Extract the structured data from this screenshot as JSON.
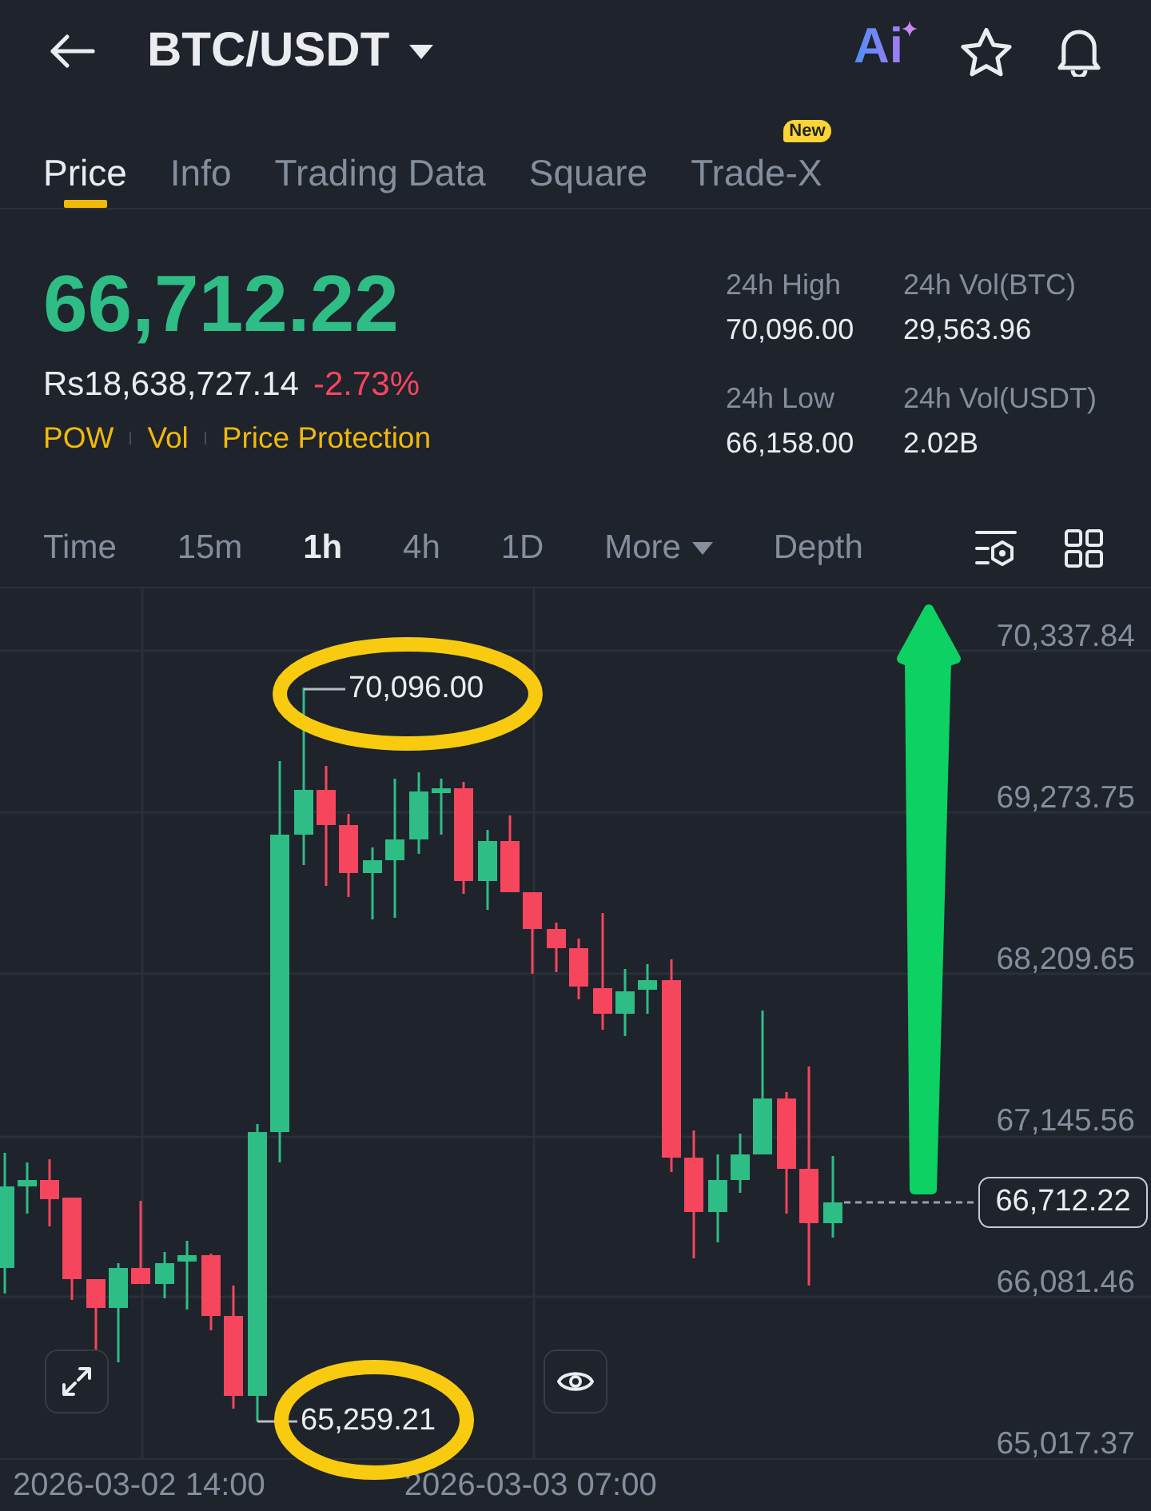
{
  "header": {
    "title": "BTC/USDT",
    "ai_label": "Ai"
  },
  "tabs": [
    {
      "label": "Price",
      "selected": true
    },
    {
      "label": "Info",
      "selected": false
    },
    {
      "label": "Trading Data",
      "selected": false
    },
    {
      "label": "Square",
      "selected": false
    },
    {
      "label": "Trade-X",
      "selected": false,
      "badge": "New"
    }
  ],
  "ticker": {
    "price": "66,712.22",
    "fiat_price": "Rs18,638,727.14",
    "change": "-2.73%",
    "tags": [
      "POW",
      "Vol",
      "Price Protection"
    ]
  },
  "stats": [
    {
      "label": "24h High",
      "value": "70,096.00"
    },
    {
      "label": "24h Vol(BTC)",
      "value": "29,563.96"
    },
    {
      "label": "24h Low",
      "value": "66,158.00"
    },
    {
      "label": "24h Vol(USDT)",
      "value": "2.02B"
    }
  ],
  "intervals": [
    {
      "label": "Time",
      "kind": "option",
      "selected": false
    },
    {
      "label": "15m",
      "kind": "option",
      "selected": false
    },
    {
      "label": "1h",
      "kind": "option",
      "selected": true
    },
    {
      "label": "4h",
      "kind": "option",
      "selected": false
    },
    {
      "label": "1D",
      "kind": "option",
      "selected": false
    },
    {
      "label": "More",
      "kind": "dropdown",
      "selected": false
    },
    {
      "label": "Depth",
      "kind": "option",
      "selected": false
    }
  ],
  "chart": {
    "price_axis": [
      "70,337.84",
      "69,273.75",
      "68,209.65",
      "67,145.56",
      "66,081.46",
      "65,017.37"
    ],
    "high_label": "70,096.00",
    "low_label": "65,259.21",
    "last_price": "66,712.22",
    "time_axis": [
      "2026-03-02 14:00",
      "2026-03-03 07:00"
    ]
  }
}
